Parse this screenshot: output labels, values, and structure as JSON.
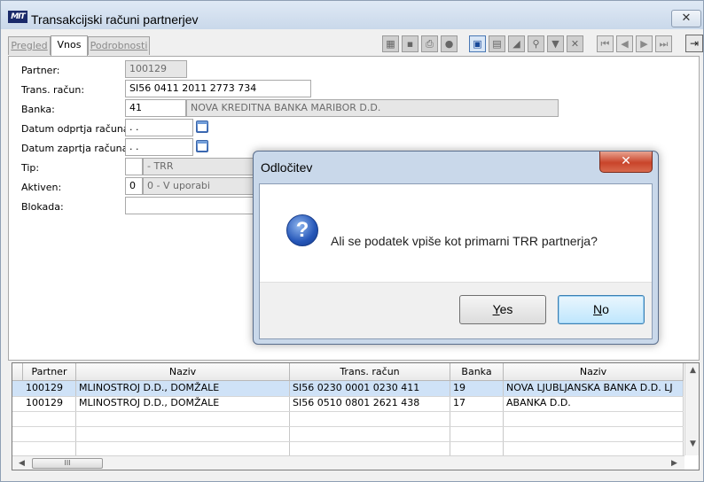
{
  "window": {
    "title": "Transakcijski računi partnerjev",
    "close_glyph": "✕",
    "logo": "MIT"
  },
  "tabs": [
    {
      "label": "Pregled"
    },
    {
      "label": "Vnos"
    },
    {
      "label": "Podrobnosti"
    }
  ],
  "toolbar": {
    "exit_glyph": "⇥"
  },
  "form": {
    "partner": {
      "label": "Partner:",
      "value": "100129"
    },
    "trans_racun": {
      "label": "Trans. račun:",
      "value": "SI56 0411 2011 2773 734"
    },
    "banka": {
      "label": "Banka:",
      "code": "41",
      "name": "NOVA KREDITNA BANKA MARIBOR D.D."
    },
    "datum_odprtja": {
      "label": "Datum odprtja računa:",
      "value": " .  ."
    },
    "datum_zaprtja": {
      "label": "Datum zaprtja računa:",
      "value": " .  ."
    },
    "tip": {
      "label": "Tip:",
      "code": "",
      "name": "- TRR"
    },
    "aktiven": {
      "label": "Aktiven:",
      "code": "0",
      "name": "0 - V uporabi"
    },
    "blokada": {
      "label": "Blokada:",
      "value": ""
    }
  },
  "grid": {
    "columns": [
      "Partner",
      "Naziv",
      "Trans. račun",
      "Banka",
      "Naziv"
    ],
    "rows": [
      [
        "100129",
        "MLINOSTROJ D.D., DOMŽALE",
        "SI56 0230 0001 0230 411",
        "19",
        "NOVA LJUBLJANSKA BANKA D.D. LJ"
      ],
      [
        "100129",
        "MLINOSTROJ D.D., DOMŽALE",
        "SI56 0510 0801 2621 438",
        "17",
        "ABANKA D.D."
      ]
    ],
    "row_indicator": "▶",
    "scroll_thumb_grip": "III"
  },
  "dialog": {
    "title": "Odločitev",
    "close_glyph": "✕",
    "icon_glyph": "?",
    "message": "Ali se podatek vpiše kot primarni TRR partnerja?",
    "yes": {
      "mnemonic": "Y",
      "rest": "es"
    },
    "no": {
      "mnemonic": "N",
      "rest": "o"
    }
  }
}
